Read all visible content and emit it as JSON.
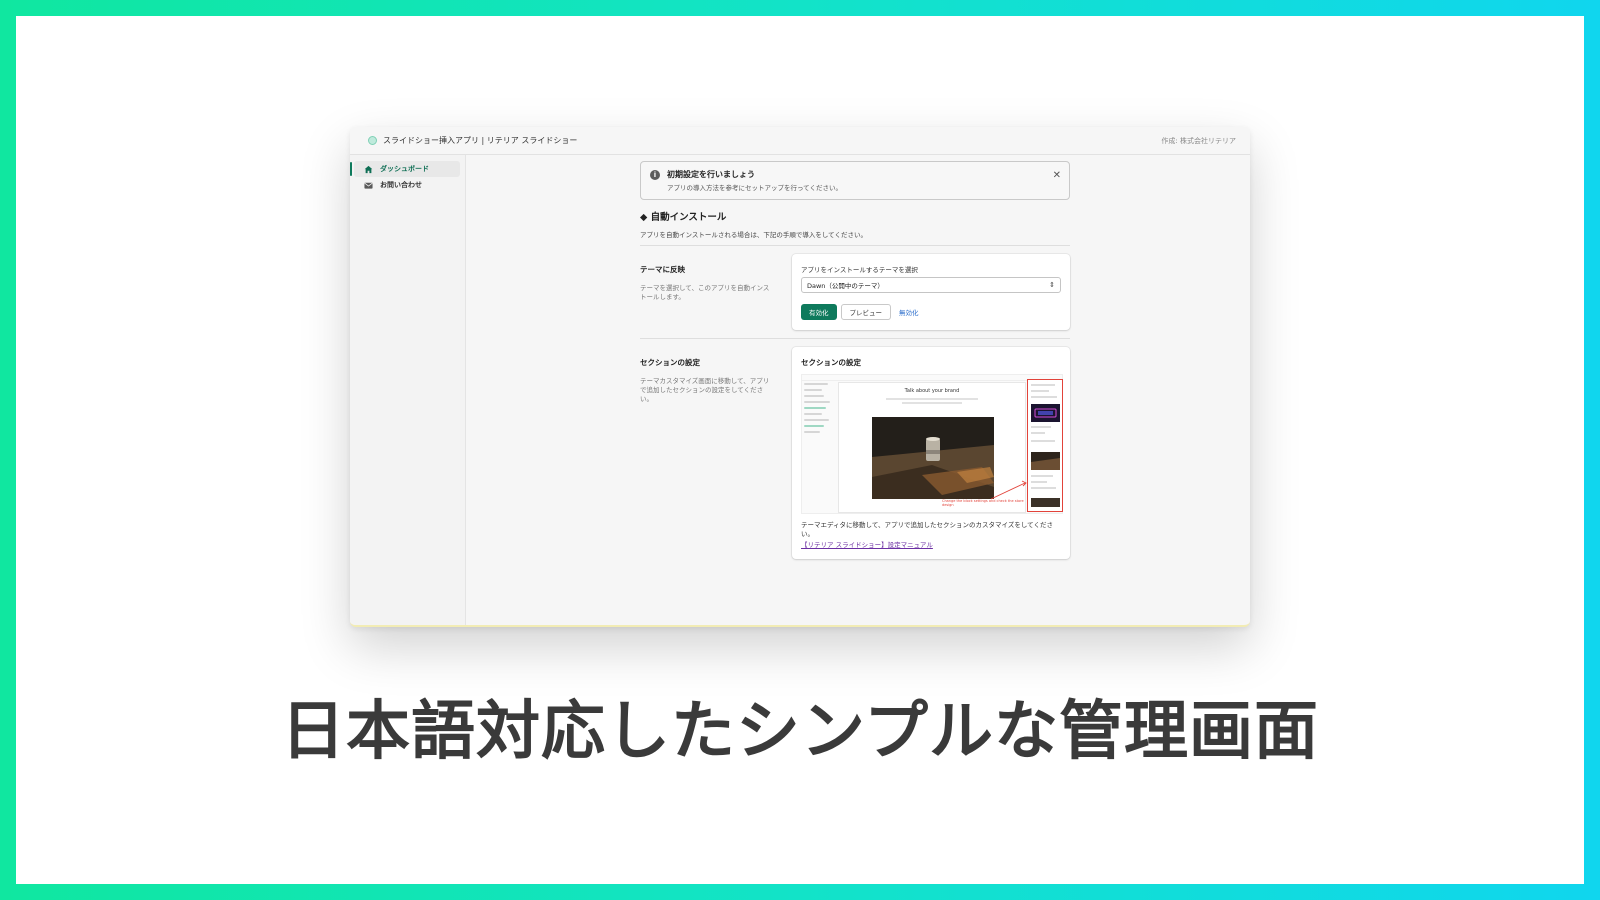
{
  "colors": {
    "accent": "#0e7a5c",
    "link": "#2c6ecb",
    "frame_left": "#10e7a0",
    "frame_right": "#10d6ee"
  },
  "app": {
    "title": "スライドショー挿入アプリ | リテリア スライドショー",
    "author": "作成: 株式会社リテリア"
  },
  "sidebar": {
    "items": [
      {
        "label": "ダッシュボード",
        "icon": "home-icon"
      },
      {
        "label": "お問い合わせ",
        "icon": "mail-icon"
      }
    ]
  },
  "banner": {
    "title": "初期設定を行いましょう",
    "text": "アプリの導入方法を参考にセットアップを行ってください。"
  },
  "auto_install": {
    "heading": "◆ 自動インストール",
    "description": "アプリを自動インストールされる場合は、下記の手順で導入をしてください。"
  },
  "theme_section": {
    "title": "テーマに反映",
    "text": "テーマを選択して、このアプリを自動インストールします。",
    "select_label": "アプリをインストールするテーマを選択",
    "select_value": "Dawn（公開中のテーマ）",
    "enable_label": "有効化",
    "preview_label": "プレビュー",
    "disable_label": "無効化"
  },
  "section_settings": {
    "title": "セクションの設定",
    "text": "テーマカスタマイズ画面に移動して、アプリで追加したセクションの設定をしてください。",
    "card_title": "セクションの設定",
    "preview_title": "Talk about your brand",
    "preview_note": "Change the block settings and check the store design",
    "footer_text": "テーマエディタに移動して、アプリで追加したセクションのカスタマイズをしてください。",
    "manual_link": "【リテリア スライドショー】設定マニュアル"
  },
  "caption": "日本語対応したシンプルな管理画面"
}
